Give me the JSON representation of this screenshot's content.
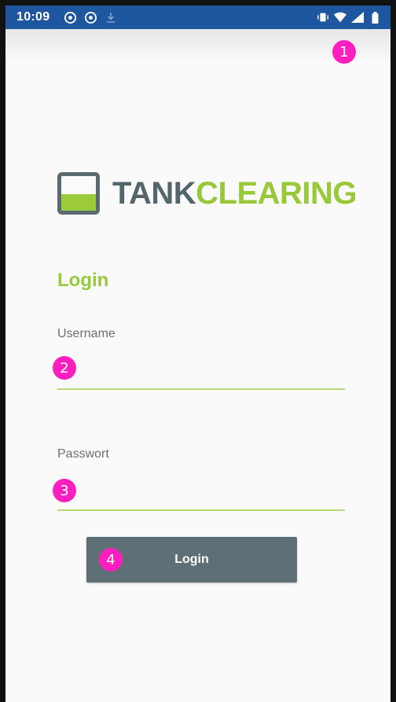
{
  "status_bar": {
    "time": "10:09",
    "left_icons": [
      "chrome-icon",
      "chrome-icon",
      "download-icon"
    ],
    "right_icons": [
      "vibrate-icon",
      "wifi-icon",
      "signal-icon",
      "battery-icon"
    ],
    "color": "#1e56a0"
  },
  "annotations": [
    "1",
    "2",
    "3",
    "4"
  ],
  "logo": {
    "part1": "TANK",
    "part2": "CLEARING"
  },
  "login": {
    "title": "Login",
    "username_label": "Username",
    "password_label": "Passwort",
    "username_value": "",
    "password_value": "",
    "button_label": "Login"
  },
  "colors": {
    "accent": "#97c93a",
    "dark": "#5e7075",
    "badge": "#ff1fbf"
  }
}
